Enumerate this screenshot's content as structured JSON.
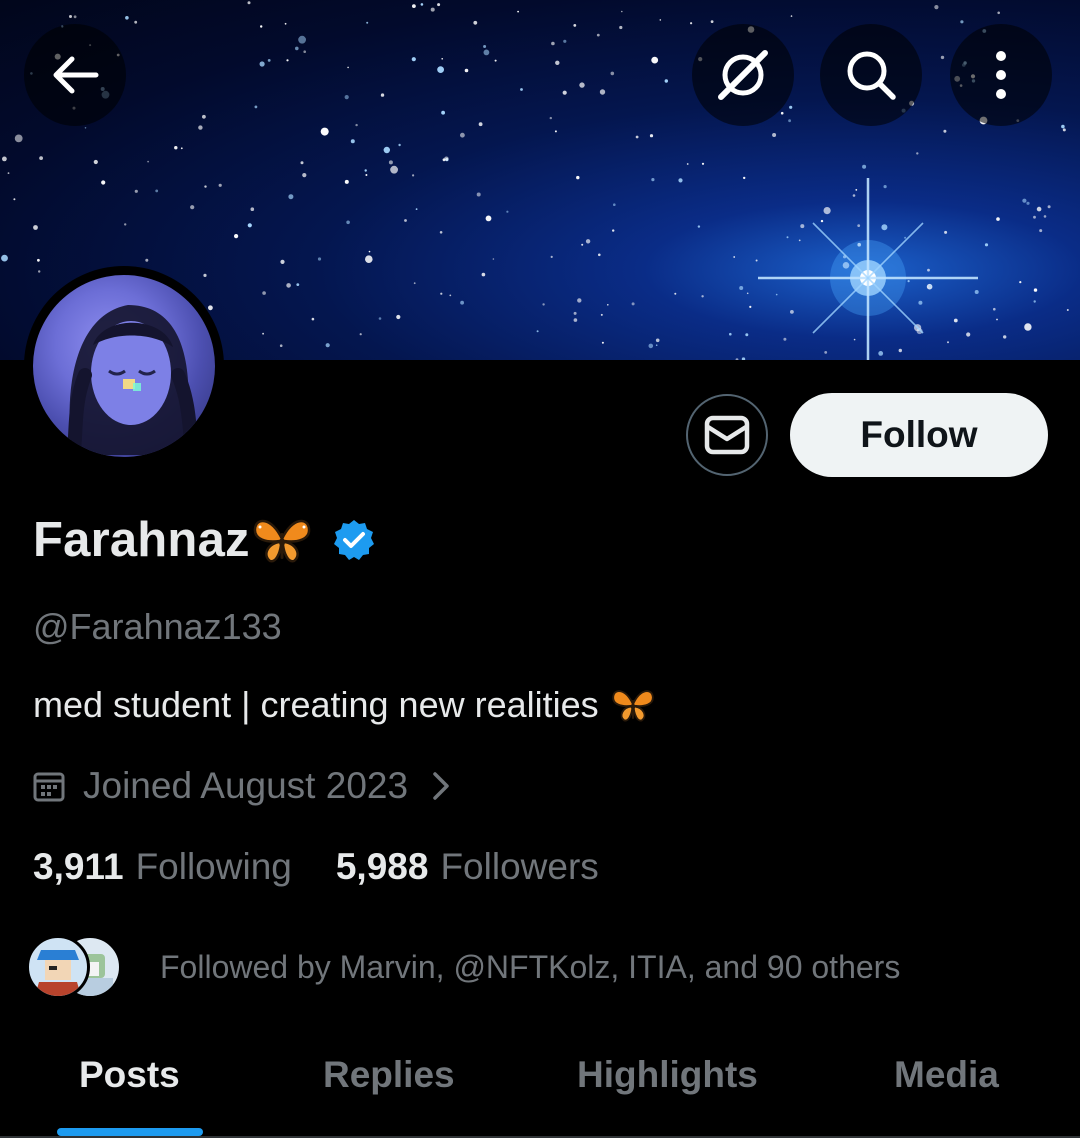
{
  "profile": {
    "display_name": "Farahnaz",
    "handle": "@Farahnaz133",
    "bio": "med student | creating new realities",
    "joined": "Joined August 2023",
    "following_count": "3,911",
    "following_label": "Following",
    "followers_count": "5,988",
    "followers_label": "Followers",
    "followed_by": "Followed by Marvin, @NFTKolz, ITIA, and 90 others"
  },
  "actions": {
    "follow_label": "Follow"
  },
  "header_icons": [
    "back-arrow-icon",
    "grok-icon",
    "search-icon",
    "more-vertical-icon"
  ],
  "profile_icons": [
    "butterfly-emoji",
    "verified-badge-icon",
    "calendar-icon",
    "chevron-right-icon",
    "mail-icon"
  ],
  "tabs": [
    {
      "label": "Posts",
      "active": true
    },
    {
      "label": "Replies",
      "active": false
    },
    {
      "label": "Highlights",
      "active": false
    },
    {
      "label": "Media",
      "active": false
    }
  ],
  "colors": {
    "accent": "#1d9bf0",
    "background": "#000000",
    "primary_text": "#e7e9ea",
    "secondary_text": "#71767b",
    "follow_button_bg": "#eff3f4"
  }
}
